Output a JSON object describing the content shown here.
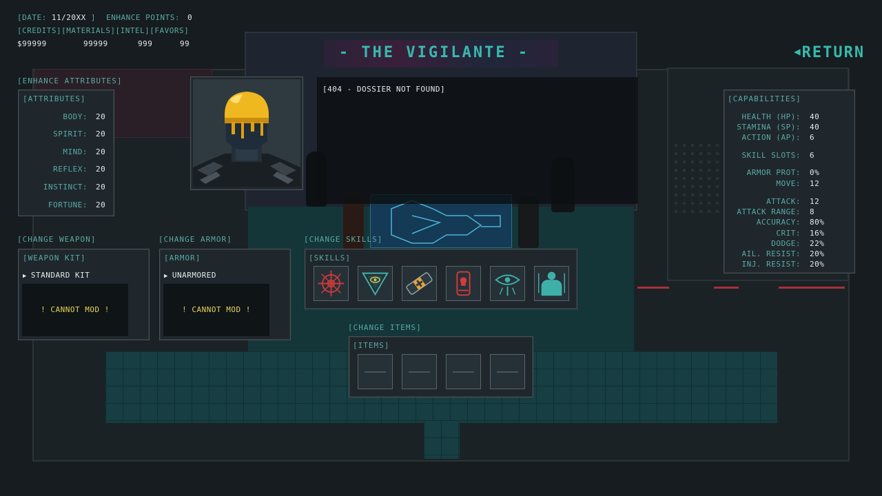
{
  "header": {
    "date_label": "[DATE:",
    "date_value": "11/20XX",
    "date_close": "]",
    "enhance_points_label": "ENHANCE POINTS:",
    "enhance_points_value": "0",
    "resources_label": "[CREDITS][MATERIALS][INTEL][FAVORS]",
    "credits": "$99999",
    "materials": "99999",
    "intel": "999",
    "favors": "99"
  },
  "title": "- THE VIGILANTE -",
  "return_label": "RETURN",
  "dossier_text": "[404 - DOSSIER NOT FOUND]",
  "attributes": {
    "section_label": "[ENHANCE ATTRIBUTES]",
    "panel_label": "[ATTRIBUTES]",
    "rows": [
      {
        "key": "BODY:",
        "value": "20"
      },
      {
        "key": "SPIRIT:",
        "value": "20"
      },
      {
        "key": "MIND:",
        "value": "20"
      },
      {
        "key": "REFLEX:",
        "value": "20"
      },
      {
        "key": "INSTINCT:",
        "value": "20"
      },
      {
        "key": "FORTUNE:",
        "value": "20"
      }
    ]
  },
  "weapon": {
    "section_label": "[CHANGE WEAPON]",
    "panel_label": "[WEAPON KIT]",
    "selected": "STANDARD KIT",
    "mod_text": "! CANNOT MOD !"
  },
  "armor": {
    "section_label": "[CHANGE ARMOR]",
    "panel_label": "[ARMOR]",
    "selected": "UNARMORED",
    "mod_text": "! CANNOT MOD !"
  },
  "skills": {
    "section_label": "[CHANGE SKILLS]",
    "panel_label": "[SKILLS]",
    "icons": [
      "crosshair-icon",
      "pyramid-eye-icon",
      "bandage-icon",
      "skull-capsule-icon",
      "watching-eye-icon",
      "figure-aura-icon"
    ]
  },
  "items": {
    "section_label": "[CHANGE ITEMS]",
    "panel_label": "[ITEMS]",
    "slots": 4
  },
  "capabilities": {
    "panel_label": "[CAPABILITIES]",
    "rows": [
      {
        "key": "HEALTH (HP):",
        "value": "40"
      },
      {
        "key": "STAMINA (SP):",
        "value": "40"
      },
      {
        "key": "ACTION (AP):",
        "value": "6"
      },
      {
        "key": "SKILL SLOTS:",
        "value": "6"
      },
      {
        "key": "ARMOR PROT:",
        "value": "0%"
      },
      {
        "key": "MOVE:",
        "value": "12"
      },
      {
        "key": "ATTACK:",
        "value": "12"
      },
      {
        "key": "ATTACK RANGE:",
        "value": "8"
      },
      {
        "key": "ACCURACY:",
        "value": "80%"
      },
      {
        "key": "CRIT:",
        "value": "16%"
      },
      {
        "key": "DODGE:",
        "value": "22%"
      },
      {
        "key": "AIL. RESIST:",
        "value": "20%"
      },
      {
        "key": "INJ. RESIST:",
        "value": "20%"
      }
    ]
  },
  "colors": {
    "accent": "#38b9ae",
    "label": "#5aa9a3",
    "warning": "#e8d45a",
    "helmet": "#f0b820",
    "panel_bg": "#1f272d"
  }
}
